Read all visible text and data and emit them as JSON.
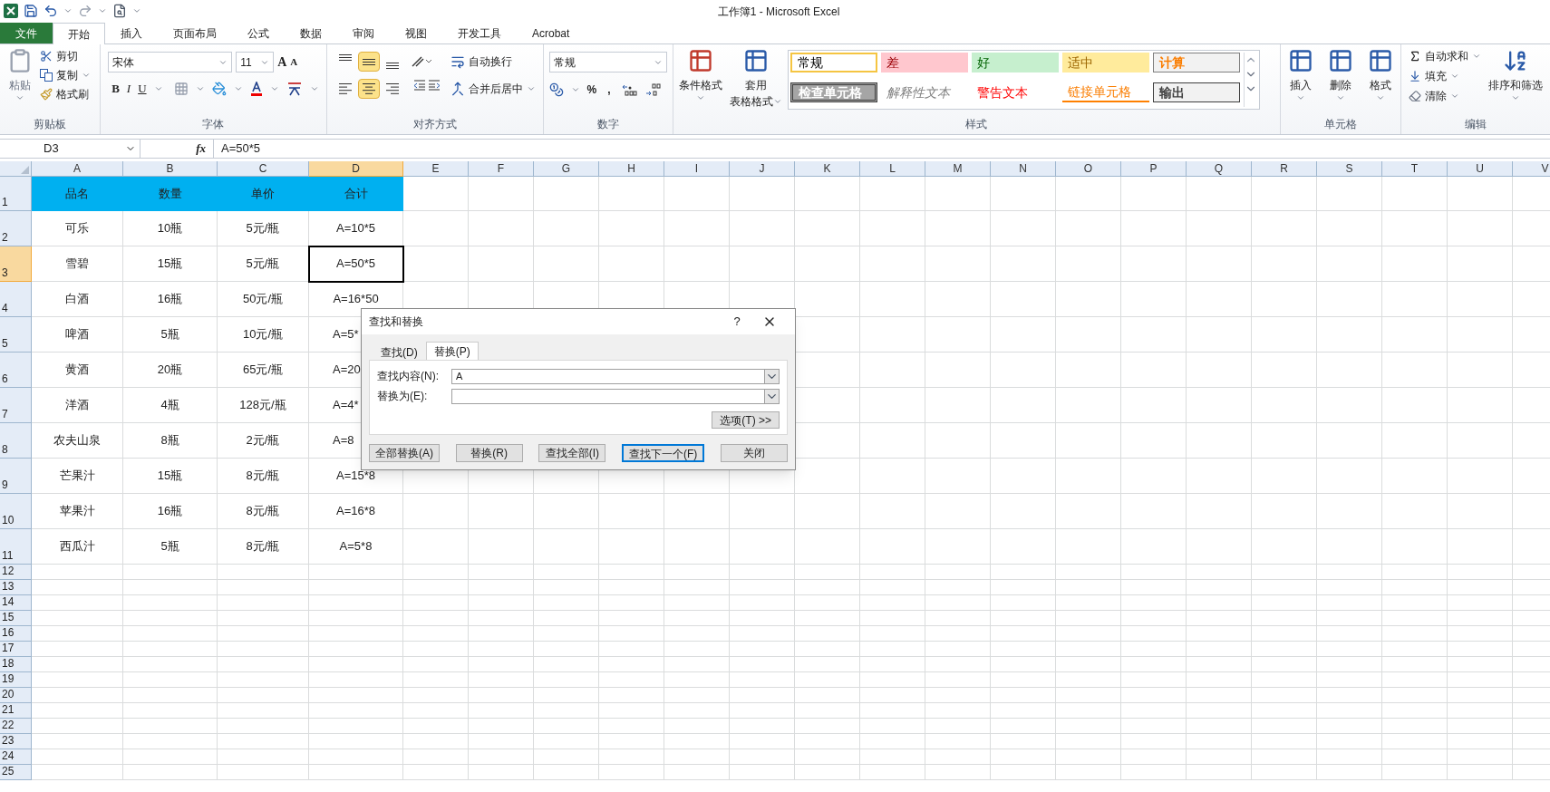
{
  "window": {
    "title": "工作簿1 - Microsoft Excel"
  },
  "tabs": [
    {
      "label": "文件",
      "kind": "file",
      "selected": false
    },
    {
      "label": "开始",
      "kind": "tab",
      "selected": true
    },
    {
      "label": "插入",
      "kind": "tab",
      "selected": false
    },
    {
      "label": "页面布局",
      "kind": "tab",
      "selected": false
    },
    {
      "label": "公式",
      "kind": "tab",
      "selected": false
    },
    {
      "label": "数据",
      "kind": "tab",
      "selected": false
    },
    {
      "label": "审阅",
      "kind": "tab",
      "selected": false
    },
    {
      "label": "视图",
      "kind": "tab",
      "selected": false
    },
    {
      "label": "开发工具",
      "kind": "tab",
      "selected": false
    },
    {
      "label": "Acrobat",
      "kind": "tab",
      "selected": false
    }
  ],
  "ribbon": {
    "clipboard": {
      "label": "剪贴板",
      "paste": "粘贴",
      "cut": "剪切",
      "copy": "复制",
      "format_painter": "格式刷"
    },
    "font": {
      "label": "字体",
      "font_name": "宋体",
      "font_size": "11",
      "grow": "A",
      "shrink": "A",
      "bold": "B",
      "italic": "I",
      "underline": "U"
    },
    "alignment": {
      "label": "对齐方式",
      "vertical": [
        {
          "kind": "top",
          "selected": false
        },
        {
          "kind": "middle",
          "selected": true
        },
        {
          "kind": "bottom",
          "selected": false
        }
      ],
      "horizontal": [
        {
          "kind": "left",
          "selected": false
        },
        {
          "kind": "center",
          "selected": true
        },
        {
          "kind": "right",
          "selected": false
        }
      ],
      "wrap_text": "自动换行",
      "merge_center": "合并后居中"
    },
    "number": {
      "label": "数字",
      "format": "常规",
      "percent": "%",
      "comma": ","
    },
    "styles": {
      "label": "样式",
      "conditional": "条件格式",
      "table_format": [
        "套用",
        "表格格式"
      ],
      "cells": [
        {
          "text": "常规",
          "kind": "normal"
        },
        {
          "text": "差",
          "kind": "bad"
        },
        {
          "text": "好",
          "kind": "good"
        },
        {
          "text": "适中",
          "kind": "neutral"
        },
        {
          "text": "计算",
          "kind": "calculation"
        },
        {
          "text": "检查单元格",
          "kind": "check"
        },
        {
          "text": "解释性文本",
          "kind": "explanatory"
        },
        {
          "text": "警告文本",
          "kind": "warning"
        },
        {
          "text": "链接单元格",
          "kind": "linked"
        },
        {
          "text": "输出",
          "kind": "output"
        }
      ]
    },
    "cells": {
      "label": "单元格",
      "insert": "插入",
      "delete": "删除",
      "format": "格式"
    },
    "editing": {
      "label": "编辑",
      "autosum": "自动求和",
      "fill": "填充",
      "clear": "清除",
      "sort_filter": "排序和筛选"
    }
  },
  "formula_bar": {
    "name_box": "D3",
    "function": "fx",
    "formula": "A=50*5"
  },
  "sheet": {
    "columns": [
      {
        "label": "A",
        "selected": false
      },
      {
        "label": "B",
        "selected": false
      },
      {
        "label": "C",
        "selected": false
      },
      {
        "label": "D",
        "selected": true
      },
      {
        "label": "E",
        "selected": false
      },
      {
        "label": "F",
        "selected": false
      },
      {
        "label": "G",
        "selected": false
      },
      {
        "label": "H",
        "selected": false
      },
      {
        "label": "I",
        "selected": false
      },
      {
        "label": "J",
        "selected": false
      },
      {
        "label": "K",
        "selected": false
      },
      {
        "label": "L",
        "selected": false
      },
      {
        "label": "M",
        "selected": false
      },
      {
        "label": "N",
        "selected": false
      },
      {
        "label": "O",
        "selected": false
      },
      {
        "label": "P",
        "selected": false
      },
      {
        "label": "Q",
        "selected": false
      },
      {
        "label": "R",
        "selected": false
      },
      {
        "label": "S",
        "selected": false
      },
      {
        "label": "T",
        "selected": false
      },
      {
        "label": "U",
        "selected": false
      },
      {
        "label": "V",
        "selected": false
      }
    ],
    "rows": [
      {
        "label": "1",
        "selected": false,
        "kind": "header",
        "cells": [
          "品名",
          "数量",
          "单价",
          "合计"
        ]
      },
      {
        "label": "2",
        "selected": false,
        "kind": "data",
        "cells": [
          "可乐",
          "10瓶",
          "5元/瓶",
          "A=10*5"
        ]
      },
      {
        "label": "3",
        "selected": true,
        "kind": "data",
        "cells": [
          "雪碧",
          "15瓶",
          "5元/瓶",
          "A=50*5"
        ]
      },
      {
        "label": "4",
        "selected": false,
        "kind": "data",
        "cells": [
          "白酒",
          "16瓶",
          "50元/瓶",
          "A=16*50"
        ]
      },
      {
        "label": "5",
        "selected": false,
        "kind": "data",
        "covered": true,
        "cells": [
          "啤酒",
          "5瓶",
          "10元/瓶",
          "A=5*"
        ]
      },
      {
        "label": "6",
        "selected": false,
        "kind": "data",
        "covered": true,
        "cells": [
          "黄酒",
          "20瓶",
          "65元/瓶",
          "A=20"
        ]
      },
      {
        "label": "7",
        "selected": false,
        "kind": "data",
        "covered": true,
        "cells": [
          "洋酒",
          "4瓶",
          "128元/瓶",
          "A=4*"
        ]
      },
      {
        "label": "8",
        "selected": false,
        "kind": "data",
        "covered": true,
        "cells": [
          "农夫山泉",
          "8瓶",
          "2元/瓶",
          "A=8"
        ]
      },
      {
        "label": "9",
        "selected": false,
        "kind": "data",
        "cells": [
          "芒果汁",
          "15瓶",
          "8元/瓶",
          "A=15*8"
        ]
      },
      {
        "label": "10",
        "selected": false,
        "kind": "data",
        "cells": [
          "苹果汁",
          "16瓶",
          "8元/瓶",
          "A=16*8"
        ]
      },
      {
        "label": "11",
        "selected": false,
        "kind": "data",
        "cells": [
          "西瓜汁",
          "5瓶",
          "8元/瓶",
          "A=5*8"
        ]
      },
      {
        "label": "12",
        "selected": false,
        "kind": "empty"
      },
      {
        "label": "13",
        "selected": false,
        "kind": "empty"
      },
      {
        "label": "14",
        "selected": false,
        "kind": "empty"
      },
      {
        "label": "15",
        "selected": false,
        "kind": "empty"
      },
      {
        "label": "16",
        "selected": false,
        "kind": "empty"
      },
      {
        "label": "17",
        "selected": false,
        "kind": "empty"
      },
      {
        "label": "18",
        "selected": false,
        "kind": "empty"
      },
      {
        "label": "19",
        "selected": false,
        "kind": "empty"
      },
      {
        "label": "20",
        "selected": false,
        "kind": "empty"
      },
      {
        "label": "21",
        "selected": false,
        "kind": "empty"
      },
      {
        "label": "22",
        "selected": false,
        "kind": "empty"
      },
      {
        "label": "23",
        "selected": false,
        "kind": "empty"
      },
      {
        "label": "24",
        "selected": false,
        "kind": "empty"
      },
      {
        "label": "25",
        "selected": false,
        "kind": "empty"
      }
    ]
  },
  "dialog": {
    "title": "查找和替换",
    "help": "?",
    "tabs": [
      {
        "label": "查找(D)",
        "selected": false
      },
      {
        "label": "替换(P)",
        "selected": true
      }
    ],
    "fields": [
      {
        "label": "查找内容(N):",
        "value": "A"
      },
      {
        "label": "替换为(E):"
      }
    ],
    "options_button": "选项(T) >>",
    "buttons": [
      {
        "label": "全部替换(A)",
        "default": false
      },
      {
        "label": "替换(R)",
        "default": false
      },
      {
        "label": "查找全部(I)",
        "default": false
      },
      {
        "label": "查找下一个(F)",
        "default": true
      },
      {
        "label": "关闭",
        "default": false
      }
    ]
  }
}
